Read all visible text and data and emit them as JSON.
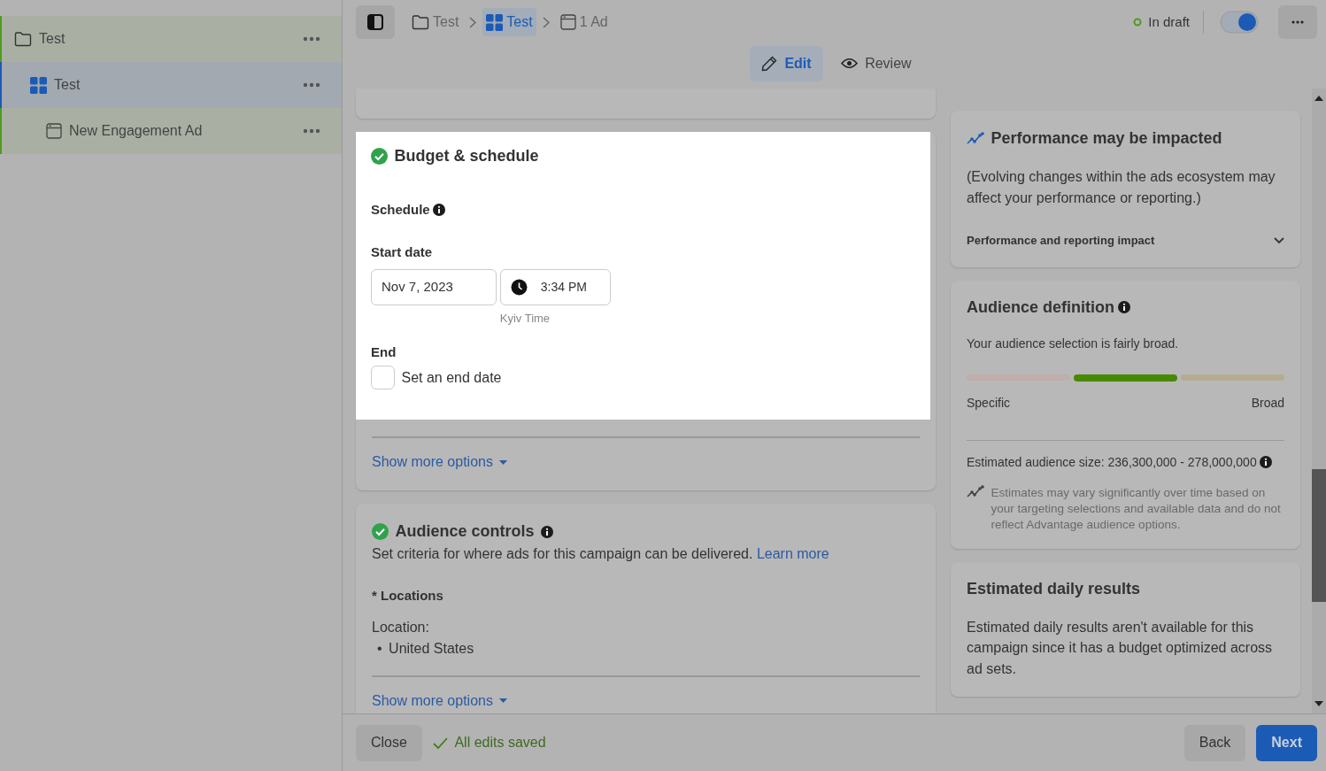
{
  "sidebar": {
    "items": [
      {
        "label": "Test",
        "kind": "folder",
        "selected": false,
        "children": [
          {
            "label": "Test",
            "kind": "campaign",
            "selected": true,
            "children": [
              {
                "label": "New Engagement Ad",
                "kind": "ad",
                "selected": false
              }
            ]
          }
        ]
      }
    ]
  },
  "breadcrumbs": [
    {
      "label": "Test",
      "kind": "folder",
      "selected": false
    },
    {
      "label": "Test",
      "kind": "campaign",
      "selected": true
    },
    {
      "label": "1 Ad",
      "kind": "ad",
      "selected": false
    }
  ],
  "status": {
    "label": "In draft",
    "toggle_on": true
  },
  "view_tabs": [
    {
      "label": "Edit",
      "kind": "edit",
      "selected": true
    },
    {
      "label": "Review",
      "kind": "review",
      "selected": false
    }
  ],
  "budget_schedule": {
    "title": "Budget & schedule",
    "complete": true,
    "highlighted": true,
    "schedule_label": "Schedule",
    "start_date_label": "Start date",
    "start_date": "Nov 7, 2023",
    "start_time": "3:34 PM",
    "timezone": "Kyiv Time",
    "end_label": "End",
    "end_checkbox": {
      "label": "Set an end date",
      "checked": false
    },
    "show_more": "Show more options"
  },
  "audience_controls": {
    "title": "Audience controls",
    "complete": true,
    "description": "Set criteria for where ads for this campaign can be delivered.",
    "link": "Learn more",
    "locations_label": "* Locations",
    "location_label": "Location:",
    "locations": [
      {
        "bullet": "•",
        "label": "United States"
      }
    ],
    "show_more": "Show more options"
  },
  "performance": {
    "title": "Performance may be impacted",
    "body": "(Evolving changes within the ads ecosystem may affect your performance or reporting.)",
    "dropdown": "Performance and reporting impact",
    "expanded": false
  },
  "audience_definition": {
    "title": "Audience definition",
    "description": "Your audience selection is fairly broad.",
    "segments": [
      {
        "color": "#bfaeab",
        "selected": false
      },
      {
        "color": "#478a00",
        "selected": true
      },
      {
        "color": "#b6ab90",
        "selected": false
      }
    ],
    "left_label": "Specific",
    "right_label": "Broad",
    "size_text": "Estimated audience size: 236,300,000 - 278,000,000",
    "note": "Estimates may vary significantly over time based on your targeting selections and available data and do not reflect Advantage audience options."
  },
  "daily_results": {
    "title": "Estimated daily results",
    "body": "Estimated daily results aren't available for this campaign since it has a budget optimized across ad sets."
  },
  "footer": {
    "close": "Close",
    "saved": "All edits saved",
    "back": "Back",
    "next": "Next"
  }
}
